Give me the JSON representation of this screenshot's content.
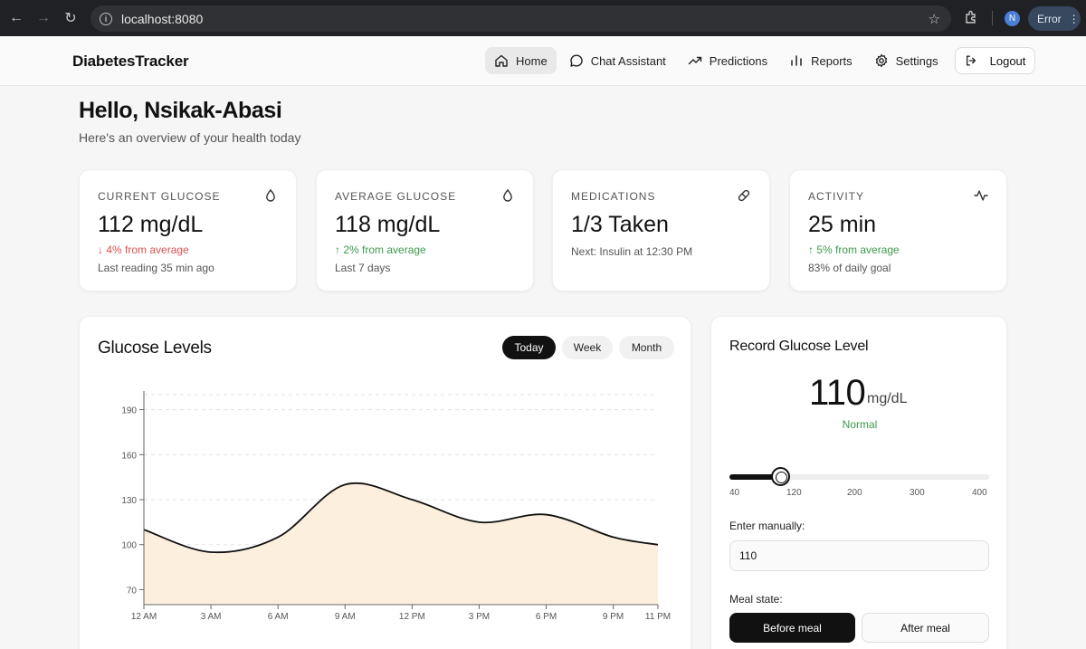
{
  "browser": {
    "url": "localhost:8080",
    "profile_initial": "N",
    "error_label": "Error"
  },
  "app": {
    "brand": "DiabetesTracker",
    "nav": [
      {
        "label": "Home",
        "icon": "home-icon",
        "active": true
      },
      {
        "label": "Chat Assistant",
        "icon": "chat-icon",
        "active": false
      },
      {
        "label": "Predictions",
        "icon": "trending-up-icon",
        "active": false
      },
      {
        "label": "Reports",
        "icon": "bar-chart-icon",
        "active": false
      },
      {
        "label": "Settings",
        "icon": "gear-icon",
        "active": false
      }
    ],
    "logout_label": "Logout"
  },
  "greeting": {
    "title": "Hello, Nsikak-Abasi",
    "subtitle": "Here's an overview of your health today"
  },
  "stats": [
    {
      "label": "CURRENT GLUCOSE",
      "value": "112 mg/dL",
      "delta": "↓ 4% from average",
      "delta_dir": "down",
      "note": "Last reading 35 min ago",
      "icon": "droplet-icon"
    },
    {
      "label": "AVERAGE GLUCOSE",
      "value": "118 mg/dL",
      "delta": "↑ 2% from average",
      "delta_dir": "up",
      "note": "Last 7 days",
      "icon": "droplet-icon"
    },
    {
      "label": "MEDICATIONS",
      "value": "1/3 Taken",
      "delta": "",
      "delta_dir": "",
      "note": "Next: Insulin at 12:30 PM",
      "icon": "pill-icon"
    },
    {
      "label": "ACTIVITY",
      "value": "25 min",
      "delta": "↑ 5% from average",
      "delta_dir": "up",
      "note": "83% of daily goal",
      "icon": "activity-icon"
    }
  ],
  "glucose_chart": {
    "title": "Glucose Levels",
    "ranges": [
      "Today",
      "Week",
      "Month"
    ],
    "active_range": "Today"
  },
  "chart_data": {
    "type": "area",
    "title": "Glucose Levels",
    "x": [
      "12 AM",
      "3 AM",
      "6 AM",
      "9 AM",
      "12 PM",
      "3 PM",
      "6 PM",
      "9 PM",
      "11 PM"
    ],
    "x_hours": [
      0,
      3,
      6,
      9,
      12,
      15,
      18,
      21,
      23
    ],
    "values": [
      110,
      95,
      105,
      140,
      130,
      115,
      120,
      105,
      100
    ],
    "yticks": [
      70,
      100,
      130,
      160,
      190
    ],
    "ylim": [
      60,
      200
    ],
    "xlim": [
      0,
      23
    ],
    "grid": true,
    "fill_color": "#fcefdd",
    "line_color": "#111111"
  },
  "record": {
    "title": "Record Glucose Level",
    "value": "110",
    "unit": "mg/dL",
    "status": "Normal",
    "slider": {
      "min": 40,
      "max": 400,
      "value": 110,
      "ticks": [
        "40",
        "120",
        "200",
        "300",
        "400"
      ]
    },
    "manual_label": "Enter manually:",
    "manual_value": "110",
    "meal_label": "Meal state:",
    "meal_options": [
      "Before meal",
      "After meal"
    ],
    "meal_selected": "Before meal"
  },
  "colors": {
    "accent_dark": "#111111",
    "down": "#d9534f",
    "up": "#3e9a4e"
  }
}
